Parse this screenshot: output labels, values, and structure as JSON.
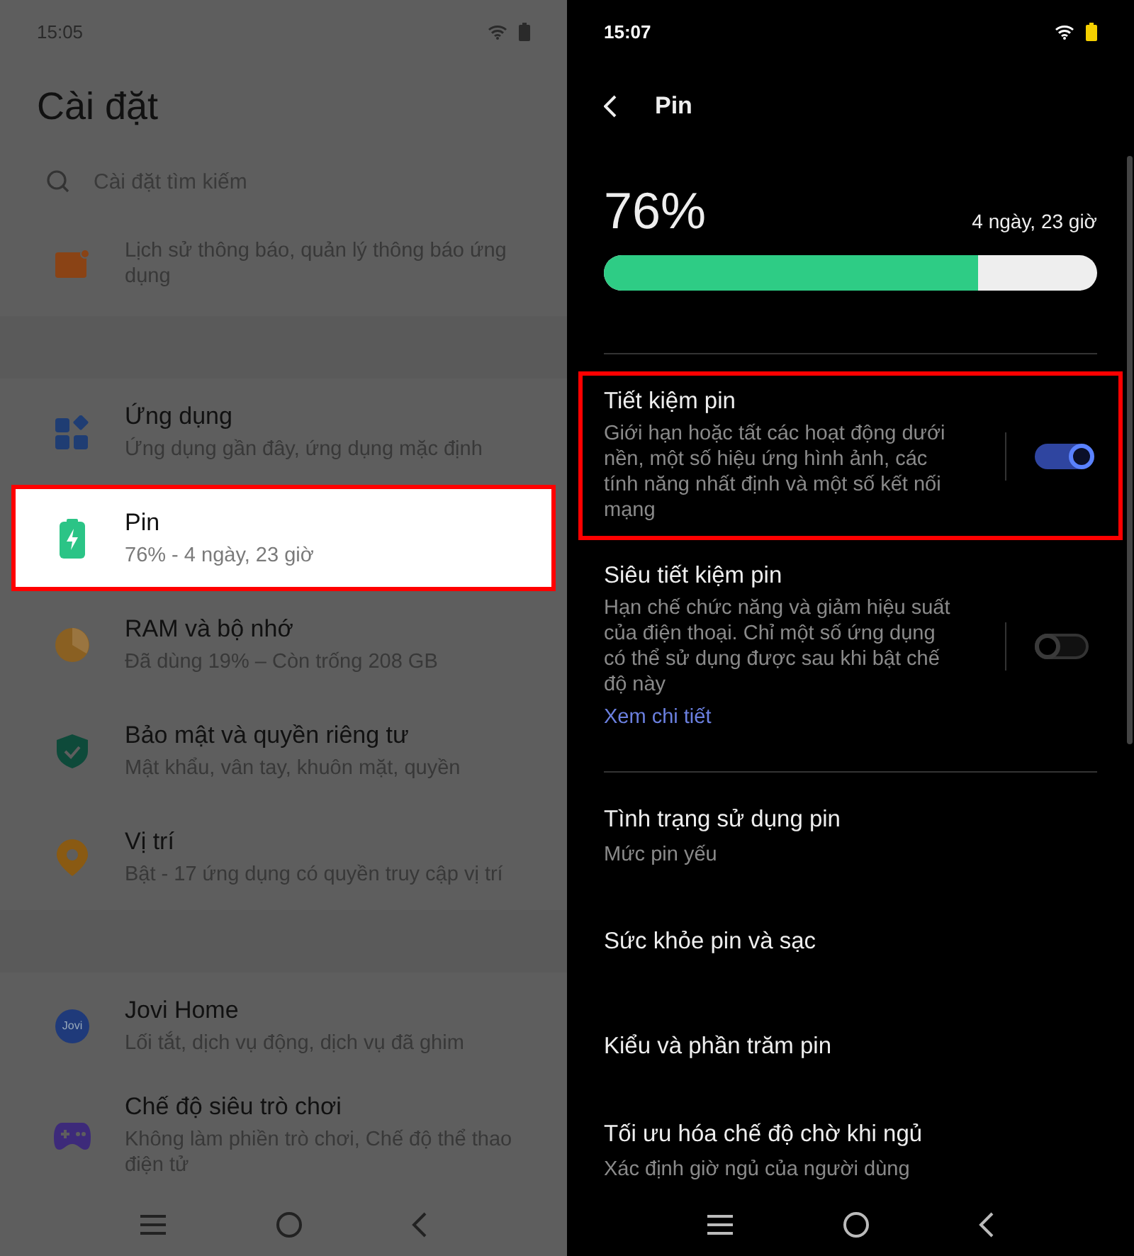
{
  "left": {
    "status_bar": {
      "time": "15:05"
    },
    "title": "Cài đặt",
    "search": {
      "placeholder": "Cài đặt tìm kiếm"
    },
    "groups": [
      [
        {
          "subtitle": "Lịch sử thông báo, quản lý thông báo ứng dụng",
          "highlighted": false
        }
      ],
      [
        {
          "title": "Ứng dụng",
          "subtitle": "Ứng dụng gần đây, ứng dụng mặc định",
          "highlighted": false
        },
        {
          "title": "Pin",
          "subtitle": "76% - 4 ngày, 23 giờ",
          "highlighted": true
        },
        {
          "title": "RAM và bộ nhớ",
          "subtitle": "Đã dùng 19% – Còn trống 208 GB",
          "highlighted": false
        },
        {
          "title": "Bảo mật và quyền riêng tư",
          "subtitle": "Mật khẩu, vân tay, khuôn mặt, quyền",
          "highlighted": false
        },
        {
          "title": "Vị trí",
          "subtitle": "Bật - 17 ứng dụng có quyền truy cập vị trí",
          "highlighted": false
        }
      ],
      [
        {
          "title": "Jovi Home",
          "subtitle": "Lối tắt, dịch vụ động, dịch vụ đã ghim",
          "icon_label": "Jovi",
          "highlighted": false
        },
        {
          "title": "Chế độ siêu trò chơi",
          "subtitle": "Không làm phiền trò chơi, Chế độ thể thao điện tử",
          "highlighted": false
        }
      ]
    ]
  },
  "right": {
    "status_bar": {
      "time": "15:07"
    },
    "header": {
      "title": "Pin"
    },
    "battery": {
      "percent": "76%",
      "remaining": "4 ngày, 23 giờ",
      "level": 0.76
    },
    "toggles": [
      {
        "title": "Tiết kiệm pin",
        "description": "Giới hạn hoặc tất các hoạt động dưới nền, một số hiệu ứng hình ảnh, các tính năng nhất định và một số kết nối mạng",
        "on": true,
        "highlighted": true
      },
      {
        "title": "Siêu tiết kiệm pin",
        "description": "Hạn chế chức năng và giảm hiệu suất của điện thoại. Chỉ một số ứng dụng có thể sử dụng được sau khi bật chế độ này",
        "link": "Xem chi tiết",
        "on": false,
        "highlighted": false
      }
    ],
    "items": [
      {
        "title": "Tình trạng sử dụng pin",
        "subtitle": "Mức pin yếu"
      },
      {
        "title": "Sức khỏe pin và sạc"
      },
      {
        "title": "Kiểu và phần trăm pin"
      },
      {
        "title": "Tối ưu hóa chế độ chờ khi ngủ",
        "subtitle": "Xác định giờ ngủ của người dùng"
      }
    ]
  }
}
